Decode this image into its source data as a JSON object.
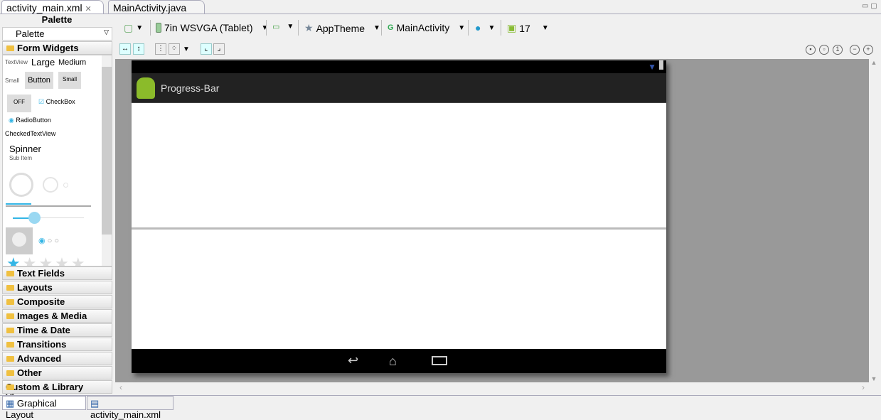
{
  "tabs": [
    {
      "label": "activity_main.xml",
      "active": true
    },
    {
      "label": "MainActivity.java",
      "active": false
    }
  ],
  "palette": {
    "title": "Palette",
    "dropdown": "Palette",
    "open_category": "Form Widgets",
    "widgets": {
      "textview": "TextView",
      "large": "Large",
      "medium": "Medium",
      "small": "Small",
      "button": "Button",
      "small_button": "Small",
      "toggle": "OFF",
      "checkbox": "CheckBox",
      "radio": "RadioButton",
      "checked_text": "CheckedTextView",
      "spinner": "Spinner",
      "sub_item": "Sub Item"
    },
    "categories": [
      "Text Fields",
      "Layouts",
      "Composite",
      "Images & Media",
      "Time & Date",
      "Transitions",
      "Advanced",
      "Other",
      "Custom & Library Views"
    ]
  },
  "toolbar": {
    "device": "7in WSVGA (Tablet)",
    "theme": "AppTheme",
    "activity": "MainActivity",
    "api": "17"
  },
  "device": {
    "app_title": "Progress-Bar",
    "progress_percent": 0
  },
  "bottom_tabs": [
    "Graphical Layout",
    "activity_main.xml"
  ],
  "colors": {
    "accent": "#33b5e5",
    "canvas": "#999999",
    "actionbar": "#222222"
  }
}
